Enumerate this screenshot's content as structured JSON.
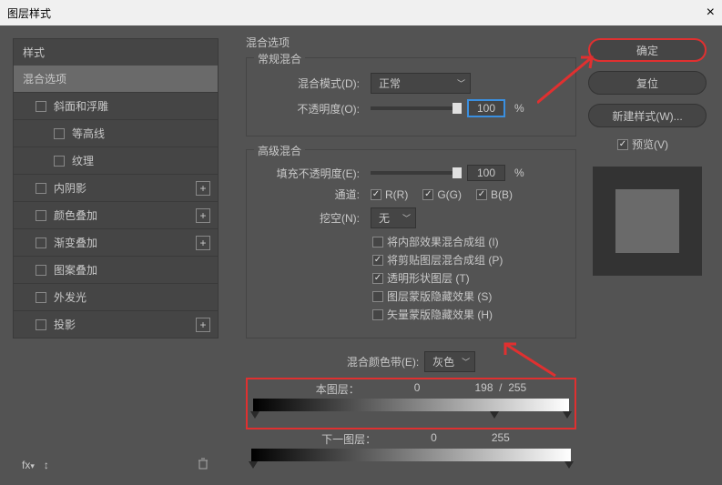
{
  "window": {
    "title": "图层样式"
  },
  "sidebar": {
    "header": "样式",
    "selected": "混合选项",
    "items": [
      {
        "label": "斜面和浮雕",
        "plus": false
      },
      {
        "label": "等高线",
        "indent": true
      },
      {
        "label": "纹理",
        "indent": true
      },
      {
        "label": "内阴影",
        "plus": true
      },
      {
        "label": "颜色叠加",
        "plus": true
      },
      {
        "label": "渐变叠加",
        "plus": true
      },
      {
        "label": "图案叠加",
        "plus": false
      },
      {
        "label": "外发光",
        "plus": false
      },
      {
        "label": "投影",
        "plus": true
      }
    ],
    "footer_fx": "fx"
  },
  "main": {
    "title": "混合选项",
    "general": {
      "legend": "常规混合",
      "blend_mode_label": "混合模式(D):",
      "blend_mode_value": "正常",
      "opacity_label": "不透明度(O):",
      "opacity_value": "100",
      "pct": "%"
    },
    "advanced": {
      "legend": "高级混合",
      "fill_opacity_label": "填充不透明度(E):",
      "fill_opacity_value": "100",
      "channels_label": "通道:",
      "ch_r": "R(R)",
      "ch_g": "G(G)",
      "ch_b": "B(B)",
      "knockout_label": "挖空(N):",
      "knockout_value": "无",
      "opts": [
        {
          "label": "将内部效果混合成组 (I)",
          "checked": false
        },
        {
          "label": "将剪贴图层混合成组 (P)",
          "checked": true
        },
        {
          "label": "透明形状图层 (T)",
          "checked": true
        },
        {
          "label": "图层蒙版隐藏效果 (S)",
          "checked": false
        },
        {
          "label": "矢量蒙版隐藏效果 (H)",
          "checked": false
        }
      ]
    },
    "blendif": {
      "label": "混合颜色带(E):",
      "value": "灰色",
      "this_layer_label": "本图层：",
      "this_low": "0",
      "this_high_a": "198",
      "this_sep": "/",
      "this_high_b": "255",
      "under_layer_label": "下一图层：",
      "under_low": "0",
      "under_high": "255"
    }
  },
  "right": {
    "ok": "确定",
    "reset": "复位",
    "new_style": "新建样式(W)...",
    "preview_label": "预览(V)"
  },
  "chart_data": {
    "type": "table",
    "title": "Blend If ranges (grayscale 0–255)",
    "rows": [
      {
        "layer": "本图层",
        "black_min": 0,
        "black_max": 0,
        "white_min": 198,
        "white_max": 255
      },
      {
        "layer": "下一图层",
        "black_min": 0,
        "black_max": 0,
        "white_min": 255,
        "white_max": 255
      }
    ]
  }
}
